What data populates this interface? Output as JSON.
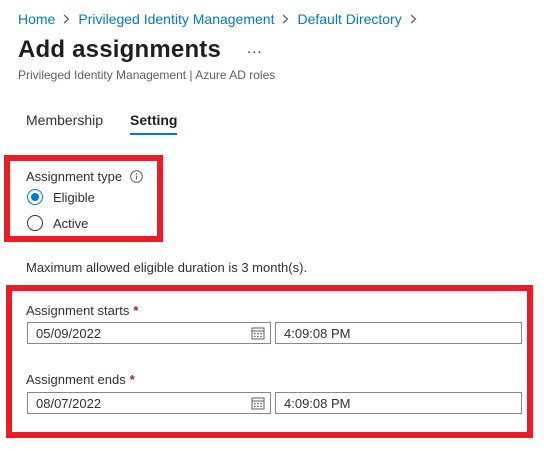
{
  "breadcrumb": {
    "items": [
      "Home",
      "Privileged Identity Management",
      "Default Directory"
    ]
  },
  "header": {
    "title": "Add assignments",
    "more": "...",
    "subtitle": "Privileged Identity Management | Azure AD roles"
  },
  "tabs": [
    {
      "label": "Membership",
      "selected": false
    },
    {
      "label": "Setting",
      "selected": true
    }
  ],
  "assignment_type": {
    "label": "Assignment type",
    "options": [
      {
        "label": "Eligible",
        "checked": true
      },
      {
        "label": "Active",
        "checked": false
      }
    ]
  },
  "note": "Maximum allowed eligible duration is 3 month(s).",
  "schedule": {
    "starts": {
      "label": "Assignment starts",
      "required_mark": "*",
      "date": "05/09/2022",
      "time": "4:09:08 PM"
    },
    "ends": {
      "label": "Assignment ends",
      "required_mark": "*",
      "date": "08/07/2022",
      "time": "4:09:08 PM"
    }
  },
  "colors": {
    "accent": "#0078d4",
    "highlight": "#ed1c24",
    "required": "#a4262c"
  }
}
